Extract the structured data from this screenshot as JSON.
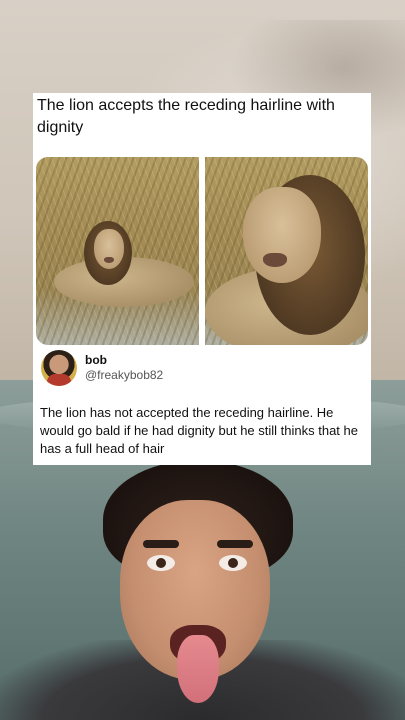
{
  "post": {
    "title": "The lion accepts the receding hairline with dignity",
    "author": {
      "name": "bob",
      "handle": "@freakybob82"
    },
    "reply_text": "The lion has not accepted the receding hairline. He would go bald if he had dignity but he still thinks that he has a full head of hair"
  }
}
